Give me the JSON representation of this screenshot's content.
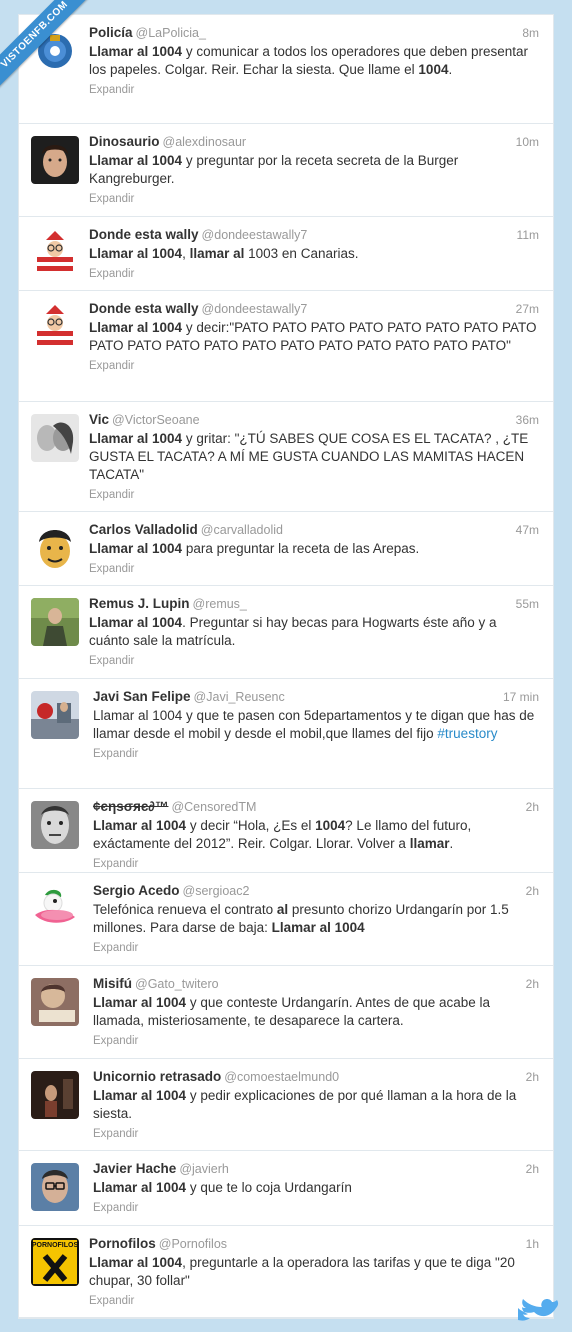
{
  "watermark": "VISTOENFB.COM",
  "expand_label": "Expandir",
  "tweets": [
    {
      "name": "Policía",
      "handle": "@LaPolicia_",
      "time": "8m",
      "avatar": "police-badge",
      "parts": [
        {
          "t": "Llamar al 1004",
          "b": true
        },
        {
          "t": " y comunicar a todos los operadores que deben presentar los papeles. Colgar. Reir. Echar la siesta. Que llame el "
        },
        {
          "t": "1004",
          "b": true
        },
        {
          "t": "."
        }
      ]
    },
    {
      "name": "Dinosaurio",
      "handle": "@alexdinosaur",
      "time": "10m",
      "avatar": "face-dark",
      "parts": [
        {
          "t": "Llamar al 1004",
          "b": true
        },
        {
          "t": " y preguntar por la receta secreta de la Burger Kangreburger."
        }
      ]
    },
    {
      "name": "Donde esta wally",
      "handle": "@dondeestawally7",
      "time": "11m",
      "avatar": "wally",
      "parts": [
        {
          "t": "Llamar al 1004",
          "b": true
        },
        {
          "t": ", "
        },
        {
          "t": "llamar al",
          "b": true
        },
        {
          "t": " 1003 en Canarias."
        }
      ]
    },
    {
      "name": "Donde esta wally",
      "handle": "@dondeestawally7",
      "time": "27m",
      "avatar": "wally",
      "parts": [
        {
          "t": "Llamar al 1004",
          "b": true
        },
        {
          "t": " y decir:\"PATO PATO PATO PATO PATO PATO PATO PATO PATO PATO PATO PATO PATO PATO PATO PATO PATO PATO PATO\""
        }
      ]
    },
    {
      "name": "Vic",
      "handle": "@VictorSeoane",
      "time": "36m",
      "avatar": "couple",
      "parts": [
        {
          "t": "Llamar al 1004",
          "b": true
        },
        {
          "t": " y gritar: \"¿TÚ SABES QUE COSA ES EL TACATA? , ¿TE GUSTA EL TACATA? A MÍ ME GUSTA CUANDO LAS MAMITAS HACEN TACATA\""
        }
      ]
    },
    {
      "name": "Carlos Valladolid",
      "handle": "@carvalladolid",
      "time": "47m",
      "avatar": "cartoon-face",
      "parts": [
        {
          "t": "Llamar al 1004",
          "b": true
        },
        {
          "t": " para preguntar la receta de las Arepas."
        }
      ]
    },
    {
      "name": "Remus J. Lupin",
      "handle": "@remus_",
      "time": "55m",
      "avatar": "forest-man",
      "parts": [
        {
          "t": "Llamar al 1004",
          "b": true
        },
        {
          "t": ". Preguntar si hay becas para Hogwarts éste año y a cuánto sale la matrícula."
        }
      ]
    },
    {
      "name": "Javi San Felipe",
      "handle": "@Javi_Reusenc",
      "time": "17 min",
      "avatar": "street",
      "parts": [
        {
          "t": "Llamar al 1004 y que te pasen con 5departamentos y te digan que has de llamar desde el mobil y desde el mobil,que llames del fijo "
        },
        {
          "t": "#truestory",
          "l": true
        }
      ]
    },
    {
      "name": "¢єηѕσяє∂™",
      "handle": "@CensoredTM",
      "time": "2h",
      "avatar": "bw-face",
      "parts": [
        {
          "t": "Llamar al 1004",
          "b": true
        },
        {
          "t": " y decir “Hola, ¿Es el "
        },
        {
          "t": "1004",
          "b": true
        },
        {
          "t": "? Le llamo del futuro, exáctamente del 2012”. Reir. Colgar. Llorar. Volver a "
        },
        {
          "t": "llamar",
          "b": true
        },
        {
          "t": "."
        }
      ]
    },
    {
      "name": "Sergio Acedo",
      "handle": "@sergioac2",
      "time": "2h",
      "avatar": "duck",
      "parts": [
        {
          "t": "Telefónica renueva el contrato "
        },
        {
          "t": "al",
          "b": true
        },
        {
          "t": " presunto chorizo Urdangarín por 1.5 millones. Para darse de baja: "
        },
        {
          "t": "Llamar al 1004",
          "b": true
        }
      ]
    },
    {
      "name": "Misifú",
      "handle": "@Gato_twitero",
      "time": "2h",
      "avatar": "reading",
      "parts": [
        {
          "t": "Llamar al 1004",
          "b": true
        },
        {
          "t": " y que conteste Urdangarín. Antes de que acabe la llamada, misteriosamente, te desaparece la cartera."
        }
      ]
    },
    {
      "name": "Unicornio retrasado",
      "handle": "@comoestaelmund0",
      "time": "2h",
      "avatar": "dark-room",
      "parts": [
        {
          "t": "Llamar al 1004",
          "b": true
        },
        {
          "t": " y pedir explicaciones de por qué llaman a la hora de la siesta."
        }
      ]
    },
    {
      "name": "Javier Hache",
      "handle": "@javierh",
      "time": "2h",
      "avatar": "glasses-man",
      "parts": [
        {
          "t": "Llamar al 1004",
          "b": true
        },
        {
          "t": " y que te lo coja Urdangarín"
        }
      ]
    },
    {
      "name": "Pornofilos",
      "handle": "@Pornofilos",
      "time": "1h",
      "avatar": "pornofilos-logo",
      "avatar_text": "PORNOFILOS",
      "parts": [
        {
          "t": "Llamar al 1004",
          "b": true
        },
        {
          "t": ", preguntarle a la operadora las tarifas y que te diga \"20 chupar, 30 follar\""
        }
      ]
    }
  ]
}
